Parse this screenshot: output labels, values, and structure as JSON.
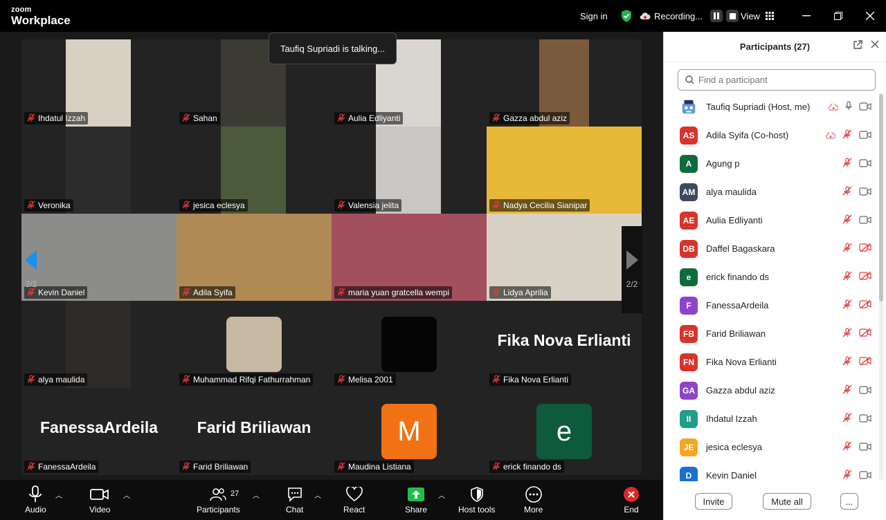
{
  "titlebar": {
    "logo_small": "zoom",
    "logo_big": "Workplace",
    "sign_in": "Sign in",
    "recording": "Recording...",
    "view": "View"
  },
  "stage": {
    "talking": "Taufiq Supriadi is talking...",
    "page_left": "2/2",
    "page_right": "2/2",
    "tiles": [
      {
        "name": "Ihdatul Izzah",
        "kind": "video",
        "bg": "#d9d0c4",
        "vx": 64,
        "vw": 94
      },
      {
        "name": "Sahan",
        "kind": "video",
        "bg": "#3b3a33",
        "vx": 64,
        "vw": 94
      },
      {
        "name": "Aulia Edliyanti",
        "kind": "video",
        "bg": "#d9d6d2",
        "vx": 64,
        "vw": 94
      },
      {
        "name": "Gazza abdul aziz",
        "kind": "video",
        "bg": "#7a5a3c",
        "vx": 76,
        "vw": 72
      },
      {
        "name": "Veronika",
        "kind": "video",
        "bg": "#2d2c2c",
        "vx": 64,
        "vw": 94
      },
      {
        "name": "jesica eclesya",
        "kind": "video",
        "bg": "#4b5a3a",
        "vx": 64,
        "vw": 94
      },
      {
        "name": "Valensia jelita",
        "kind": "video",
        "bg": "#c9c6c3",
        "vx": 64,
        "vw": 94
      },
      {
        "name": "Nadya Cecilia Sianipar",
        "kind": "video",
        "bg": "#e8b83a",
        "vx": 0,
        "vw": 224
      },
      {
        "name": "Kevin Daniel",
        "kind": "video",
        "bg": "#8c8c8a",
        "vx": 0,
        "vw": 224
      },
      {
        "name": "Adila Syifa",
        "kind": "video",
        "bg": "#b08a55",
        "vx": 0,
        "vw": 224
      },
      {
        "name": "maria yuan gratcella wempi",
        "kind": "video",
        "bg": "#a24f5e",
        "vx": 0,
        "vw": 224
      },
      {
        "name": "Lidya Aprilia",
        "kind": "video",
        "bg": "#d8d2c6",
        "vx": 0,
        "vw": 224
      },
      {
        "name": "alya maulida",
        "kind": "video",
        "bg": "#2f2b29",
        "vx": 64,
        "vw": 94
      },
      {
        "name": "Muhammad Rifqi Fathurrahman",
        "kind": "photo",
        "bg": "#c7b8a4"
      },
      {
        "name": "Melisa 2001",
        "kind": "blank",
        "bg": "#050505"
      },
      {
        "name": "Fika Nova Erlianti",
        "kind": "text",
        "display": "Fika Nova Erlianti"
      },
      {
        "name": "FanessaArdeila",
        "kind": "text",
        "display": "FanessaArdeila"
      },
      {
        "name": "Farid Briliawan",
        "kind": "text",
        "display": "Farid Briliawan"
      },
      {
        "name": "Maudina Listiana",
        "kind": "letter",
        "letter": "M",
        "bg": "#f07214"
      },
      {
        "name": "erick finando ds",
        "kind": "letter",
        "letter": "e",
        "bg": "#0e5a3c"
      }
    ]
  },
  "toolbar": {
    "audio": "Audio",
    "video": "Video",
    "participants": "Participants",
    "participants_count": "27",
    "chat": "Chat",
    "react": "React",
    "share": "Share",
    "host_tools": "Host tools",
    "more": "More",
    "end": "End"
  },
  "panel": {
    "title": "Participants (27)",
    "search_placeholder": "Find a participant",
    "invite": "Invite",
    "mute_all": "Mute all",
    "more": "...",
    "participants": [
      {
        "name": "Taufiq Supriadi (Host, me)",
        "initials": "",
        "color": "#3a6fb0",
        "rec": true,
        "mic": "on",
        "cam": "on",
        "robot": true
      },
      {
        "name": "Adila Syifa (Co-host)",
        "initials": "AS",
        "color": "#d8342c",
        "rec": true,
        "mic": "off",
        "cam": "on"
      },
      {
        "name": "Agung p",
        "initials": "A",
        "color": "#0f6b3c",
        "rec": false,
        "mic": "off",
        "cam": "on"
      },
      {
        "name": "alya maulida",
        "initials": "AM",
        "color": "#3d4a5e",
        "rec": false,
        "mic": "off",
        "cam": "on"
      },
      {
        "name": "Aulia Edliyanti",
        "initials": "AE",
        "color": "#d8342c",
        "rec": false,
        "mic": "off",
        "cam": "on"
      },
      {
        "name": "Daffel Bagaskara",
        "initials": "DB",
        "color": "#d8342c",
        "rec": false,
        "mic": "off",
        "cam": "off"
      },
      {
        "name": "erick finando ds",
        "initials": "e",
        "color": "#0f6b3c",
        "rec": false,
        "mic": "off",
        "cam": "off"
      },
      {
        "name": "FanessaArdeila",
        "initials": "F",
        "color": "#8e44c8",
        "rec": false,
        "mic": "off",
        "cam": "off"
      },
      {
        "name": "Farid Briliawan",
        "initials": "FB",
        "color": "#d8342c",
        "rec": false,
        "mic": "off",
        "cam": "off"
      },
      {
        "name": "Fika Nova Erlianti",
        "initials": "FN",
        "color": "#d8342c",
        "rec": false,
        "mic": "off",
        "cam": "off"
      },
      {
        "name": "Gazza abdul aziz",
        "initials": "GA",
        "color": "#8e44c8",
        "rec": false,
        "mic": "off",
        "cam": "on"
      },
      {
        "name": "Ihdatul Izzah",
        "initials": "II",
        "color": "#1f9e8a",
        "rec": false,
        "mic": "off",
        "cam": "on"
      },
      {
        "name": "jesica eclesya",
        "initials": "JE",
        "color": "#f5a623",
        "rec": false,
        "mic": "off",
        "cam": "on"
      },
      {
        "name": "Kevin Daniel",
        "initials": "D",
        "color": "#1b6fcf",
        "rec": false,
        "mic": "off",
        "cam": "on"
      }
    ]
  }
}
